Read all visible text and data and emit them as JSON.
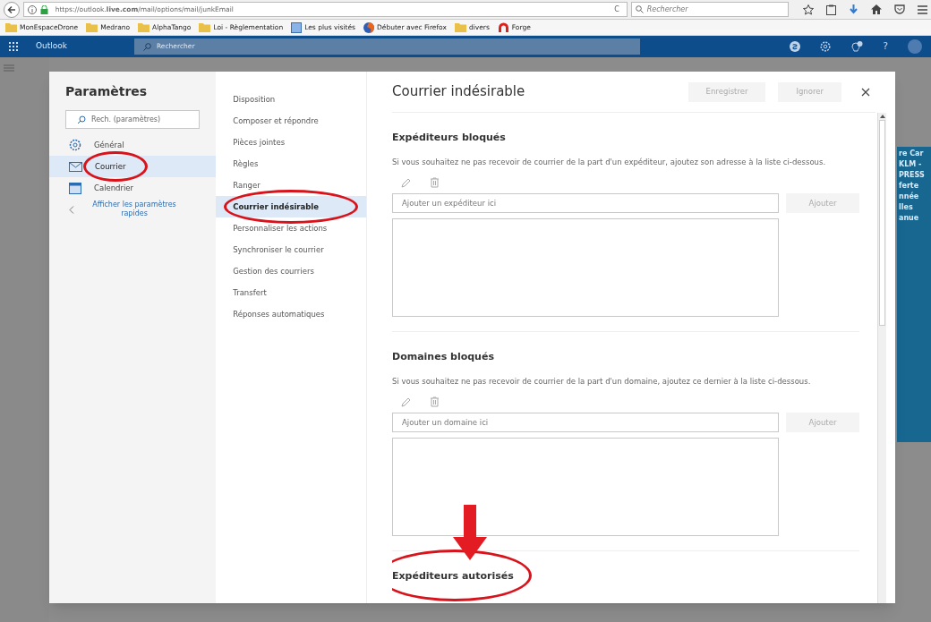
{
  "browser": {
    "url": "https://outlook.**live.com**/mail/options/mail/junkEmail",
    "reload": "C",
    "search_placeholder": "Rechercher"
  },
  "bookmarks": [
    {
      "label": "MonEspaceDrone",
      "kind": "folder"
    },
    {
      "label": "Medrano",
      "kind": "folder"
    },
    {
      "label": "AlphaTango",
      "kind": "folder"
    },
    {
      "label": "Loi - Règlementation",
      "kind": "folder"
    },
    {
      "label": "Les plus visités",
      "kind": "history"
    },
    {
      "label": "Débuter avec Firefox",
      "kind": "firefox"
    },
    {
      "label": "divers",
      "kind": "folder"
    },
    {
      "label": "Forge",
      "kind": "forge"
    }
  ],
  "app_bar": {
    "title": "Outlook",
    "search_placeholder": "Rechercher",
    "help": "?"
  },
  "settings": {
    "title": "Paramètres",
    "search_placeholder": "Rech. (paramètres)",
    "categories": [
      {
        "label": "Général",
        "selected": false,
        "circled": false
      },
      {
        "label": "Courrier",
        "selected": true,
        "circled": true
      },
      {
        "label": "Calendrier",
        "selected": false,
        "circled": false
      }
    ],
    "quick_link": "Afficher les paramètres rapides",
    "options": [
      {
        "label": "Disposition",
        "selected": false,
        "circled": false
      },
      {
        "label": "Composer et répondre",
        "selected": false,
        "circled": false
      },
      {
        "label": "Pièces jointes",
        "selected": false,
        "circled": false
      },
      {
        "label": "Règles",
        "selected": false,
        "circled": false
      },
      {
        "label": "Ranger",
        "selected": false,
        "circled": false
      },
      {
        "label": "Courrier indésirable",
        "selected": true,
        "circled": true
      },
      {
        "label": "Personnaliser les actions",
        "selected": false,
        "circled": false
      },
      {
        "label": "Synchroniser le courrier",
        "selected": false,
        "circled": false
      },
      {
        "label": "Gestion des courriers",
        "selected": false,
        "circled": false
      },
      {
        "label": "Transfert",
        "selected": false,
        "circled": false
      },
      {
        "label": "Réponses automatiques",
        "selected": false,
        "circled": false
      }
    ]
  },
  "panel": {
    "title": "Courrier indésirable",
    "buttons": [
      {
        "label": "Enregistrer",
        "disabled": true
      },
      {
        "label": "Ignorer",
        "disabled": true
      }
    ],
    "sections": [
      {
        "title": "Expéditeurs bloqués",
        "description": "Si vous souhaitez ne pas recevoir de courrier de la part d'un expéditeur, ajoutez son adresse à la liste ci-dessous.",
        "placeholder": "Ajouter un expéditeur ici",
        "add_button": "Ajouter",
        "circled": false
      },
      {
        "title": "Domaines bloqués",
        "description": "Si vous souhaitez ne pas recevoir de courrier de la part d'un domaine, ajoutez ce dernier à la liste ci-dessous.",
        "placeholder": "Ajouter un domaine ici",
        "add_button": "Ajouter",
        "circled": false
      },
      {
        "title": "Expéditeurs autorisés",
        "circled": true
      }
    ]
  },
  "background_fragments": [
    "re Car",
    "KLM -",
    "PRESS",
    "ferte",
    "nnée",
    "lles",
    "anue"
  ]
}
